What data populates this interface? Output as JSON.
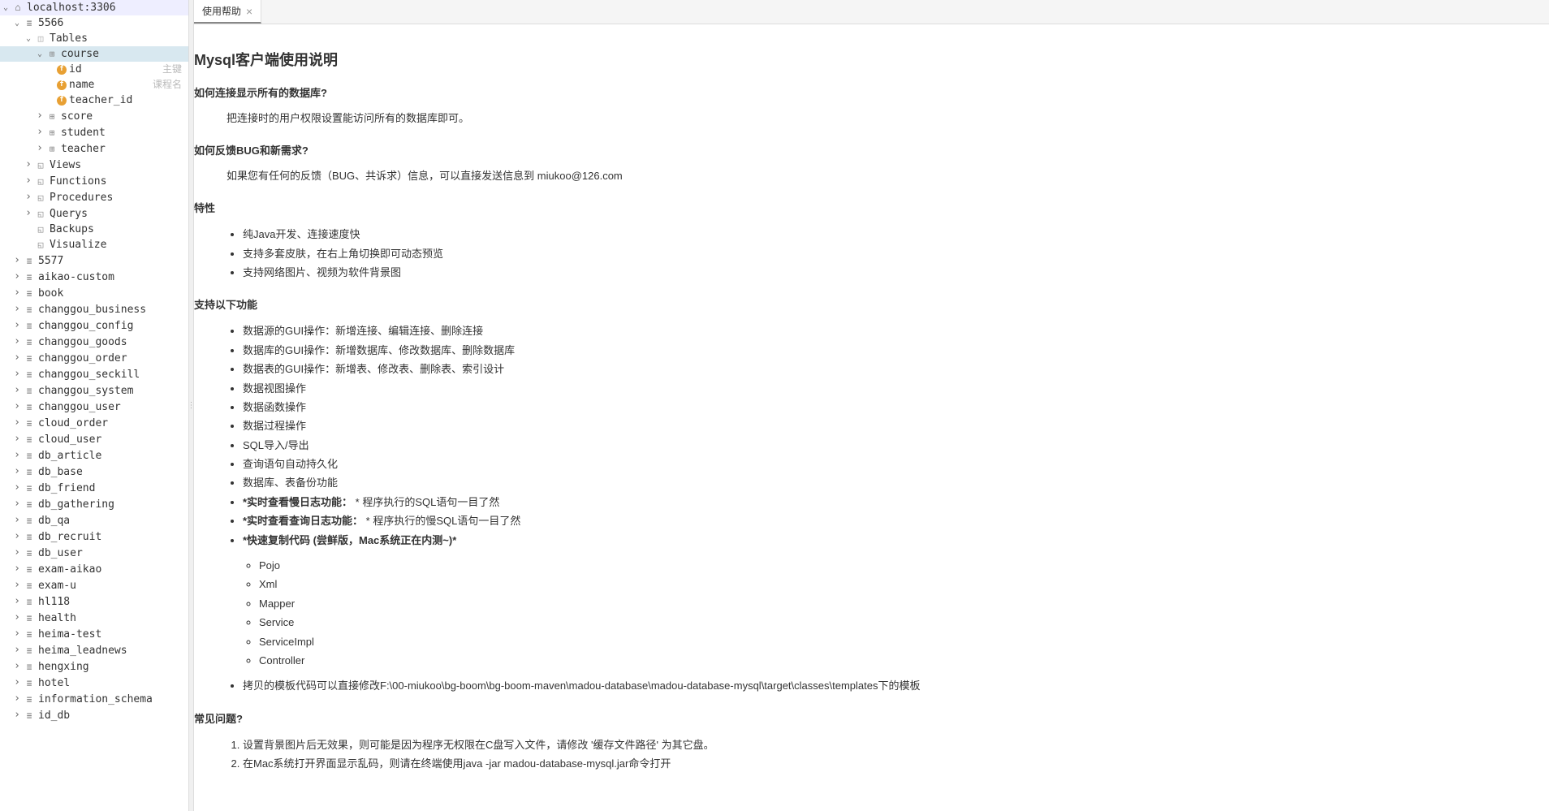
{
  "connection": {
    "host": "localhost:3306"
  },
  "tab": {
    "title": "使用帮助"
  },
  "tree": {
    "db_5566": "5566",
    "tables": "Tables",
    "course": "course",
    "course_cols": [
      {
        "name": "id",
        "note": "主键"
      },
      {
        "name": "name",
        "note": "课程名"
      },
      {
        "name": "teacher_id",
        "note": ""
      }
    ],
    "score": "score",
    "student": "student",
    "teacher": "teacher",
    "views": "Views",
    "functions": "Functions",
    "procedures": "Procedures",
    "querys": "Querys",
    "backups": "Backups",
    "visualize": "Visualize",
    "dbs": [
      "5577",
      "aikao-custom",
      "book",
      "changgou_business",
      "changgou_config",
      "changgou_goods",
      "changgou_order",
      "changgou_seckill",
      "changgou_system",
      "changgou_user",
      "cloud_order",
      "cloud_user",
      "db_article",
      "db_base",
      "db_friend",
      "db_gathering",
      "db_qa",
      "db_recruit",
      "db_user",
      "exam-aikao",
      "exam-u",
      "hl118",
      "health",
      "heima-test",
      "heima_leadnews",
      "hengxing",
      "hotel",
      "information_schema",
      "id_db"
    ]
  },
  "help": {
    "title": "Mysql客户端使用说明",
    "q1": "如何连接显示所有的数据库?",
    "a1": "把连接时的用户权限设置能访问所有的数据库即可。",
    "q2": "如何反馈BUG和新需求?",
    "a2": "如果您有任何的反馈（BUG、共诉求）信息，可以直接发送信息到 miukoo@126.com",
    "features_title": "特性",
    "features": [
      "纯Java开发、连接速度快",
      "支持多套皮肤，在右上角切换即可动态预览",
      "支持网络图片、视频为软件背景图"
    ],
    "support_title": "支持以下功能",
    "support": [
      {
        "text": "数据源的GUI操作：新增连接、编辑连接、删除连接"
      },
      {
        "text": "数据库的GUI操作：新增数据库、修改数据库、删除数据库"
      },
      {
        "text": "数据表的GUI操作：新增表、修改表、删除表、索引设计"
      },
      {
        "text": "数据视图操作"
      },
      {
        "text": "数据函数操作"
      },
      {
        "text": "数据过程操作"
      },
      {
        "text": "SQL导入/导出"
      },
      {
        "text": "查询语句自动持久化"
      },
      {
        "text": "数据库、表备份功能"
      },
      {
        "bold": "*实时查看慢日志功能：",
        "text": " * 程序执行的SQL语句一目了然"
      },
      {
        "bold": "*实时查看查询日志功能：",
        "text": " * 程序执行的慢SQL语句一目了然"
      },
      {
        "bold": "*快速复制代码 (尝鲜版，Mac系统正在内测~)*",
        "text": ""
      }
    ],
    "code_types": [
      "Pojo",
      "Xml",
      "Mapper",
      "Service",
      "ServiceImpl",
      "Controller"
    ],
    "template_note": "拷贝的模板代码可以直接修改F:\\00-miukoo\\bg-boom\\bg-boom-maven\\madou-database\\madou-database-mysql\\target\\classes\\templates下的模板",
    "faq_title": "常见问题?",
    "faq": [
      "设置背景图片后无效果，则可能是因为程序无权限在C盘写入文件，请修改 '缓存文件路径' 为其它盘。",
      "在Mac系统打开界面显示乱码，则请在终端使用java -jar madou-database-mysql.jar命令打开"
    ]
  }
}
